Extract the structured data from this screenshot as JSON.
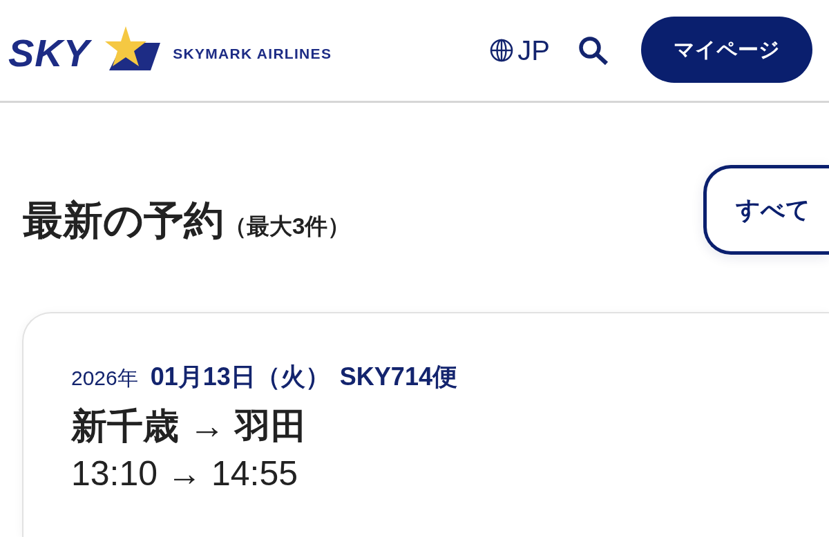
{
  "header": {
    "logo": {
      "mark": "SKY",
      "wordmark": "SKYMARK AIRLINES"
    },
    "language": "JP",
    "mypage_button": "マイページ"
  },
  "reservations": {
    "title": "最新の予約",
    "limit_note": "（最大3件）",
    "view_all_button": "すべて",
    "items": [
      {
        "year": "2026年",
        "date": "01月13日（火）",
        "flight": "SKY714便",
        "route": "新千歳 → 羽田",
        "times": "13:10 → 14:55"
      }
    ]
  }
}
